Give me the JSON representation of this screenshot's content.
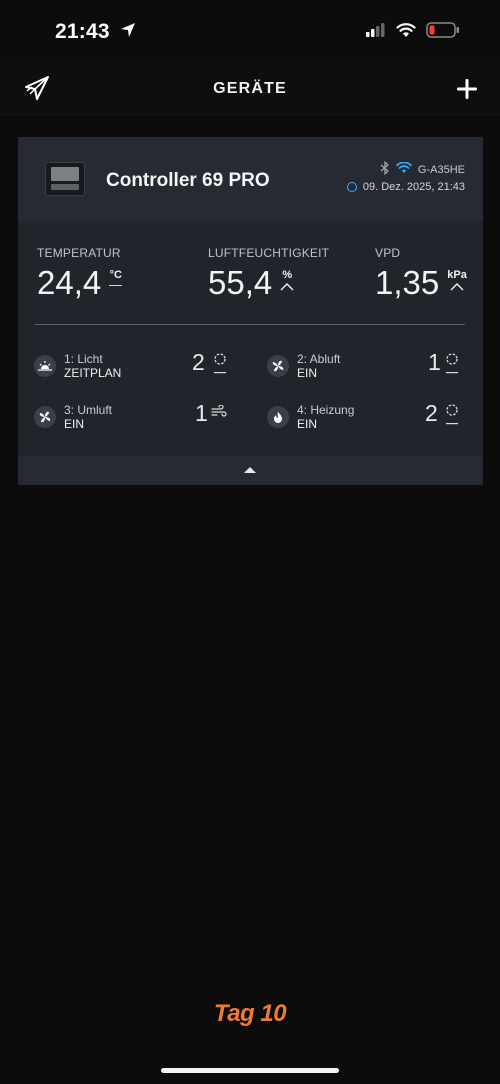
{
  "status_bar": {
    "time": "21:43"
  },
  "nav": {
    "title": "GERÄTE"
  },
  "device": {
    "name": "Controller 69 PRO",
    "connection_id": "G-A35HE",
    "timestamp": "09. Dez. 2025, 21:43"
  },
  "metrics": [
    {
      "label": "TEMPERATUR",
      "value": "24,4",
      "unit": "°C",
      "trend": "steady"
    },
    {
      "label": "LUFTFEUCHTIGKEIT",
      "value": "55,4",
      "unit": "%",
      "trend": "up"
    },
    {
      "label": "VPD",
      "value": "1,35",
      "unit": "kPa",
      "trend": "up"
    }
  ],
  "ports": [
    {
      "name": "1: Licht",
      "mode": "ZEITPLAN",
      "level": "2",
      "icon": "sun-icon",
      "indicator": "timer-icon"
    },
    {
      "name": "2: Abluft",
      "mode": "EIN",
      "level": "1",
      "icon": "fan-icon",
      "indicator": "timer-icon"
    },
    {
      "name": "3: Umluft",
      "mode": "EIN",
      "level": "1",
      "icon": "fan-icon",
      "indicator": "wind-icon"
    },
    {
      "name": "4: Heizung",
      "mode": "EIN",
      "level": "2",
      "icon": "flame-icon",
      "indicator": "timer-icon"
    }
  ],
  "caption": "Tag 10",
  "colors": {
    "accent": "#3aa7ff",
    "caption": "#f07a32",
    "battery_low": "#ff3b30"
  }
}
